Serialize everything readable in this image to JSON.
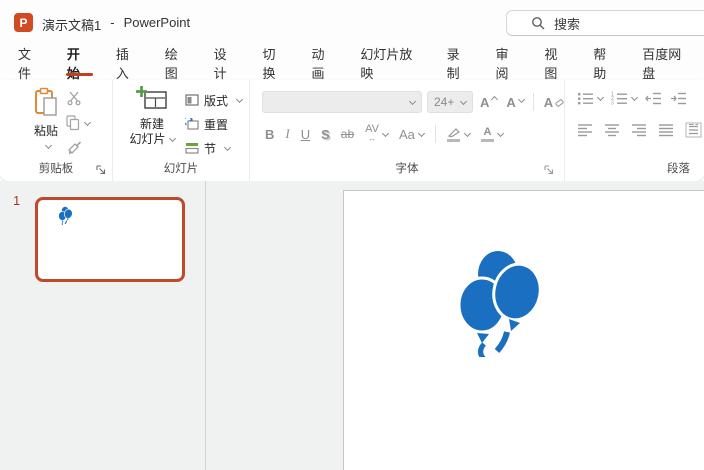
{
  "titlebar": {
    "title": "演示文稿1",
    "separator": "-",
    "app_name": "PowerPoint",
    "search_label": "搜索"
  },
  "tabs": {
    "items": [
      {
        "label": "文件",
        "active": false
      },
      {
        "label": "开始",
        "active": true
      },
      {
        "label": "插入",
        "active": false
      },
      {
        "label": "绘图",
        "active": false
      },
      {
        "label": "设计",
        "active": false
      },
      {
        "label": "切换",
        "active": false
      },
      {
        "label": "动画",
        "active": false
      },
      {
        "label": "幻灯片放映",
        "active": false
      },
      {
        "label": "录制",
        "active": false
      },
      {
        "label": "审阅",
        "active": false
      },
      {
        "label": "视图",
        "active": false
      },
      {
        "label": "帮助",
        "active": false
      },
      {
        "label": "百度网盘",
        "active": false
      }
    ]
  },
  "ribbon": {
    "clipboard": {
      "paste_label": "粘贴",
      "group_label": "剪贴板"
    },
    "slides": {
      "new_slide_line1": "新建",
      "new_slide_line2": "幻灯片",
      "layout_label": "版式",
      "reset_label": "重置",
      "section_label": "节",
      "group_label": "幻灯片"
    },
    "font": {
      "font_name_value": "",
      "font_size_value": "24+",
      "group_label": "字体",
      "glyphs": {
        "bold": "B",
        "italic": "I",
        "underline": "U",
        "shadow": "S",
        "strikethrough": "ab",
        "char_spacing": "AV",
        "spacing_arrow": "↔",
        "change_case": "Aa",
        "grow_font": "A",
        "shrink_font": "A",
        "clear_format": "A",
        "font_color": "A"
      }
    },
    "paragraph": {
      "group_label": "段落"
    }
  },
  "slides_pane": {
    "slide_number": "1"
  },
  "colors": {
    "accent_red": "#C43E1C",
    "ppt_icon_bg": "#D04A23",
    "selected_thumb_border": "#C0492C",
    "balloon_blue": "#1B6FC0",
    "disabled_gray": "#8f8f8f"
  }
}
